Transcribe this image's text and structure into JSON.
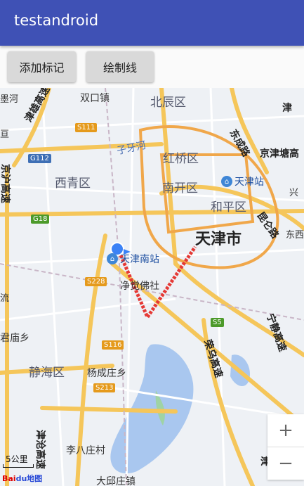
{
  "app": {
    "title": "testandroid"
  },
  "toolbar": {
    "add_marker_label": "添加标记",
    "draw_line_label": "绘制线"
  },
  "map": {
    "districts": [
      "北辰区",
      "红桥区",
      "西青区",
      "南开区",
      "和平区",
      "静海区"
    ],
    "city": "天津市",
    "places": [
      "双口镇",
      "净觉佛社",
      "杨成庄乡",
      "李八庄村",
      "君庙乡",
      "大邱庄镇"
    ],
    "river": "子牙河",
    "stations": {
      "south": "天津南站",
      "tianjin": "天津站"
    },
    "roads": {
      "jinxiong": "津雄高速",
      "dongcheng": "东成路",
      "jingjintang": "京津塘高",
      "jinghu": "京沪高速",
      "kunming": "昆仑路",
      "ninghai": "宁静高速",
      "rongwu": "荣乌高速",
      "jincang": "津沧高速"
    },
    "edge_labels": {
      "left_top": "墨河",
      "left_mid": "亘",
      "left_liu": "流",
      "right_xing": "兴",
      "right_dong": "东西",
      "right_top": "津",
      "right_bottom": "津"
    },
    "shields": [
      "S111",
      "G112",
      "G18",
      "S228",
      "S5",
      "S116",
      "S213"
    ],
    "scale_text": "5公里",
    "logo_text": {
      "bai": "Bai",
      "du": "du地图"
    },
    "zoom": {
      "in": "+",
      "out": "−"
    }
  },
  "colors": {
    "appbar": "#3f51b5",
    "drawn_line": "#e53935",
    "marker": "#3b82f6"
  }
}
